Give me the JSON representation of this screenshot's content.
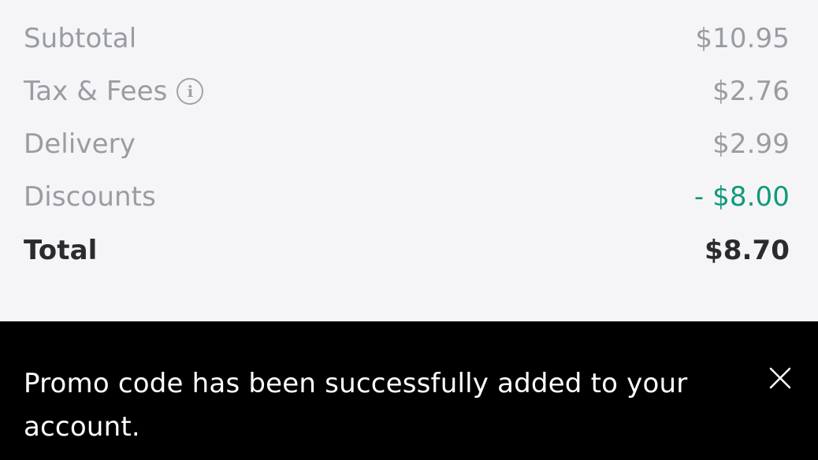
{
  "order_summary": {
    "rows": [
      {
        "label": "Subtotal",
        "value": "$10.95"
      },
      {
        "label": "Tax & Fees",
        "value": "$2.76",
        "icon": "info-icon"
      },
      {
        "label": "Delivery",
        "value": "$2.99"
      },
      {
        "label": "Discounts",
        "value": "- $8.00"
      }
    ],
    "total": {
      "label": "Total",
      "value": "$8.70"
    }
  },
  "toast": {
    "message": "Promo code has been successfully added to your account.",
    "close_icon": "close-icon"
  },
  "colors": {
    "background": "#f5f5f7",
    "muted_text": "#9a9ca3",
    "strong_text": "#2b2b2f",
    "discount": "#0f9a7a",
    "toast_bg": "#000000",
    "toast_text": "#ffffff"
  },
  "info_glyph": "i"
}
